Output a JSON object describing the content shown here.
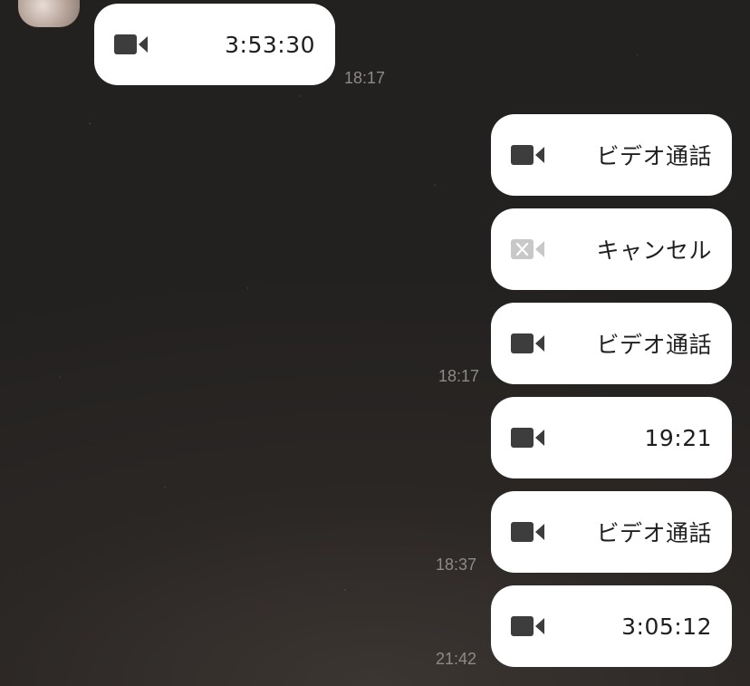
{
  "messages": [
    {
      "direction": "incoming",
      "icon": "video-camera-icon",
      "label": "3:53:30",
      "time": "18:17"
    },
    {
      "direction": "outgoing",
      "icon": "video-camera-icon",
      "label": "ビデオ通話"
    },
    {
      "direction": "outgoing",
      "icon": "video-camera-cancelled-icon",
      "label": "キャンセル"
    },
    {
      "direction": "outgoing",
      "icon": "video-camera-icon",
      "label": "ビデオ通話",
      "time": "18:17"
    },
    {
      "direction": "outgoing",
      "icon": "video-camera-icon",
      "label": "19:21"
    },
    {
      "direction": "outgoing",
      "icon": "video-camera-icon",
      "label": "ビデオ通話",
      "time": "18:37"
    },
    {
      "direction": "outgoing",
      "icon": "video-camera-icon",
      "label": "3:05:12",
      "time": "21:42"
    }
  ],
  "colors": {
    "bubble": "#ffffff",
    "icon": "#3d3d3d",
    "icon_cancelled": "#c8c8c8",
    "timestamp": "#8e8a86"
  }
}
